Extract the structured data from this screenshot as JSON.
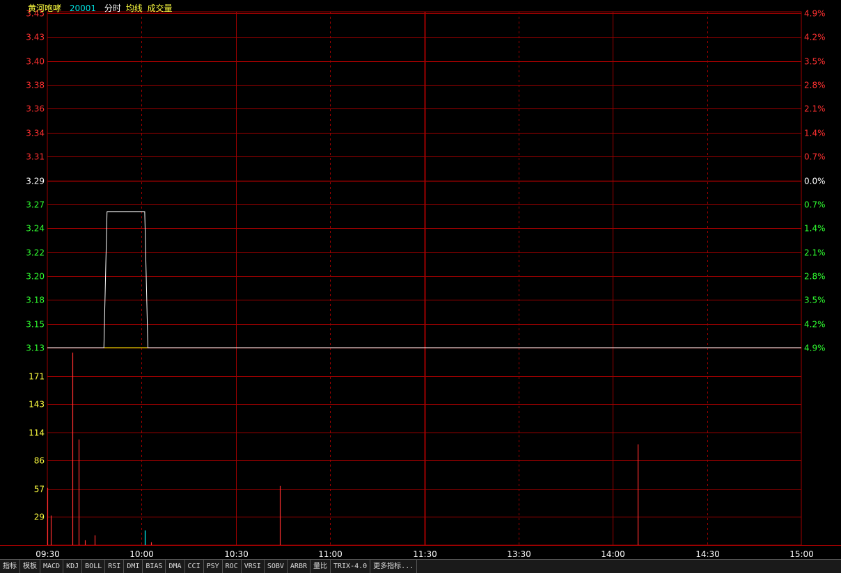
{
  "header": {
    "stock_name": "黄河咆哮",
    "code": "20001",
    "label_minute": "分时",
    "label_avg": "均线",
    "label_volume": "成交量"
  },
  "colors": {
    "up": "#ff3030",
    "down": "#30ff30",
    "neutral": "#ffffff",
    "grid": "#a00000",
    "volume_axis": "#ffff40",
    "price_line": "#ffffff",
    "avg_line": "#ffff00",
    "volume_bar": "#ff3030",
    "volume_bar_down": "#00ffff",
    "code_color": "#00e0e0",
    "name_color": "#ffff40"
  },
  "chart_data": {
    "type": "line",
    "prev_close": 3.29,
    "price_ticks": [
      "3.45",
      "3.43",
      "3.40",
      "3.38",
      "3.36",
      "3.34",
      "3.31",
      "3.29",
      "3.27",
      "3.24",
      "3.22",
      "3.20",
      "3.18",
      "3.15",
      "3.13"
    ],
    "percent_ticks": [
      "4.9%",
      "4.2%",
      "3.5%",
      "2.8%",
      "2.1%",
      "1.4%",
      "0.7%",
      "0.0%",
      "0.7%",
      "1.4%",
      "2.1%",
      "2.8%",
      "3.5%",
      "4.2%",
      "4.9%"
    ],
    "volume_ticks": [
      "171",
      "143",
      "114",
      "86",
      "57",
      "29"
    ],
    "time_ticks": [
      "09:30",
      "10:00",
      "10:30",
      "11:00",
      "11:30",
      "13:30",
      "14:00",
      "14:30",
      "15:00"
    ],
    "ylim": [
      3.13,
      3.45
    ],
    "volume_max": 200,
    "minutes_total": 240,
    "price_series": {
      "name": "分时",
      "points": [
        [
          0,
          3.13
        ],
        [
          18,
          3.13
        ],
        [
          19,
          3.26
        ],
        [
          31,
          3.26
        ],
        [
          32,
          3.13
        ],
        [
          240,
          3.13
        ]
      ]
    },
    "avg_series": {
      "name": "均线",
      "points": [
        [
          0,
          3.13
        ],
        [
          240,
          3.13
        ]
      ]
    },
    "volume_series": {
      "name": "成交量",
      "bars": [
        {
          "t": 0,
          "v": 58,
          "dir": "up"
        },
        {
          "t": 1,
          "v": 30,
          "dir": "up"
        },
        {
          "t": 8,
          "v": 195,
          "dir": "up"
        },
        {
          "t": 10,
          "v": 107,
          "dir": "up"
        },
        {
          "t": 12,
          "v": 5,
          "dir": "up"
        },
        {
          "t": 15,
          "v": 10,
          "dir": "up"
        },
        {
          "t": 31,
          "v": 15,
          "dir": "down"
        },
        {
          "t": 33,
          "v": 3,
          "dir": "up"
        },
        {
          "t": 74,
          "v": 60,
          "dir": "up"
        },
        {
          "t": 188,
          "v": 102,
          "dir": "up"
        }
      ]
    }
  },
  "tabs": [
    "指标",
    "模板",
    "MACD",
    "KDJ",
    "BOLL",
    "RSI",
    "DMI",
    "BIAS",
    "DMA",
    "CCI",
    "PSY",
    "ROC",
    "VRSI",
    "SOBV",
    "ARBR",
    "量比",
    "TRIX-4.0",
    "更多指标..."
  ]
}
